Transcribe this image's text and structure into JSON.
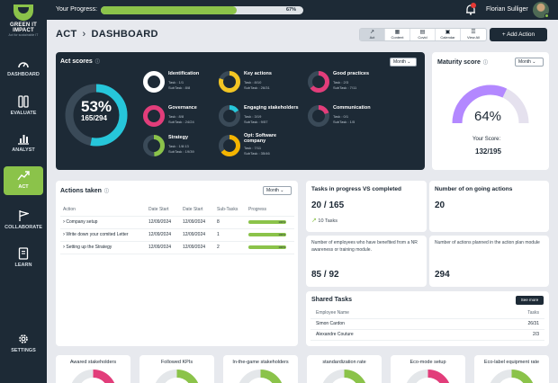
{
  "brand": {
    "name": "GREEN IT IMPACT",
    "tagline": "Act for sustainable IT"
  },
  "sidebar": {
    "items": [
      {
        "label": "DASHBOARD",
        "icon": "gauge-icon"
      },
      {
        "label": "EVALUATE",
        "icon": "evaluate-icon"
      },
      {
        "label": "ANALYST",
        "icon": "bar-chart-icon"
      },
      {
        "label": "ACT",
        "icon": "trend-up-icon",
        "active": true
      },
      {
        "label": "COLLABORATE",
        "icon": "flag-icon"
      },
      {
        "label": "LEARN",
        "icon": "book-icon"
      },
      {
        "label": "SETTINGS",
        "icon": "gear-icon"
      }
    ]
  },
  "topbar": {
    "progress_label": "Your Progress:",
    "progress_value": 0.67,
    "progress_text": "67%",
    "user_name": "Florian Sulliger",
    "notification_icon": "bell-icon",
    "accent": "#8bc34a",
    "nav_bg": "#1d2a36"
  },
  "breadcrumb": {
    "parent": "ACT",
    "current": "DASHBOARD"
  },
  "view_tabs": [
    {
      "label": "Act",
      "active": true
    },
    {
      "label": "Content"
    },
    {
      "label": "Covid"
    },
    {
      "label": "Calendar"
    },
    {
      "label": "View All"
    }
  ],
  "add_action_label": "Add Action",
  "act_scores": {
    "title": "Act scores",
    "period": "Month",
    "overall_percent": "53%",
    "overall_fraction": "165/294",
    "overall_value": 0.53,
    "items": [
      {
        "name": "Identification",
        "task": "Task : 1/1",
        "subtask": "SubTask : 8/8",
        "color": "#ffffff",
        "value": 1.0
      },
      {
        "name": "Governance",
        "task": "Task : 8/8",
        "subtask": "SubTask : 24/24",
        "color": "#e23d7a",
        "value": 1.0
      },
      {
        "name": "Strategy",
        "task": "Task : 1/8:13",
        "subtask": "SubTask : 19/39",
        "color": "#8bc34a",
        "value": 0.49
      },
      {
        "name": "Key actions",
        "task": "Task : 8/10",
        "subtask": "SubTask : 26/31",
        "color": "#f3c623",
        "value": 0.8
      },
      {
        "name": "Engaging stakeholders",
        "task": "Task : 3/19",
        "subtask": "SubTask : 9/57",
        "color": "#26c6da",
        "value": 0.16
      },
      {
        "name": "Opt: Software company",
        "task": "Task : 7/11",
        "subtask": "SubTask : 35/46",
        "color": "#f4b400",
        "value": 0.64
      },
      {
        "name": "Good practices",
        "task": "Task : 2/3",
        "subtask": "SubTask : 7/11",
        "color": "#e23d7a",
        "value": 0.64
      },
      {
        "name": "Communication",
        "task": "Task : 0/1",
        "subtask": "SubTask : 1/5",
        "color": "#e23d7a",
        "value": 0.2
      }
    ]
  },
  "maturity": {
    "title": "Maturity score",
    "period": "Month",
    "percent": "64%",
    "score_label": "Your Score:",
    "score": "132/195",
    "value": 0.64,
    "color": "#b388ff"
  },
  "actions_taken": {
    "title": "Actions taken",
    "period": "Month",
    "columns": [
      "Action",
      "Date Start",
      "Date Start",
      "Sub-Tasks",
      "Progress"
    ],
    "rows": [
      {
        "action": "Company setup",
        "date1": "12/09/2024",
        "date2": "12/09/2024",
        "subtasks": "8",
        "progress": 1.0,
        "progress_text": "100%"
      },
      {
        "action": "Write down your comited Letter",
        "date1": "12/09/2024",
        "date2": "12/09/2024",
        "subtasks": "1",
        "progress": 1.0,
        "progress_text": "100%"
      },
      {
        "action": "Setting up the Strategy",
        "date1": "12/09/2024",
        "date2": "12/09/2024",
        "subtasks": "2",
        "progress": 1.0,
        "progress_text": "100%"
      }
    ]
  },
  "tasks_progress": {
    "title": "Tasks in progress VS completed",
    "value": "20 / 165",
    "delta": "10 Tasks"
  },
  "ongoing_actions": {
    "title": "Number of on going actions",
    "value": "20"
  },
  "employees_benefited": {
    "text": "Number of employees who have benefited from a NR awareness or training module.",
    "value": "85 / 92"
  },
  "planned_actions": {
    "text": "Number of actions planned in the action plan module",
    "value": "294"
  },
  "shared_tasks": {
    "title": "Shared Tasks",
    "see_more": "See more",
    "columns": [
      "Employee Name",
      "Tasks"
    ],
    "rows": [
      {
        "name": "Simon Cardon",
        "tasks": "26/31"
      },
      {
        "name": "Alexandre Couture",
        "tasks": "2/3"
      }
    ]
  },
  "bottom_cards": [
    {
      "title": "Awared stakeholders",
      "color": "#e23d7a"
    },
    {
      "title": "Followed KPIs",
      "color": "#8bc34a"
    },
    {
      "title": "In-the-game stakeholders",
      "color": "#8bc34a"
    },
    {
      "title": "standardization rate",
      "color": "#8bc34a"
    },
    {
      "title": "Eco-mode setup",
      "color": "#e23d7a"
    },
    {
      "title": "Eco-label equipment rate",
      "color": "#8bc34a"
    }
  ]
}
